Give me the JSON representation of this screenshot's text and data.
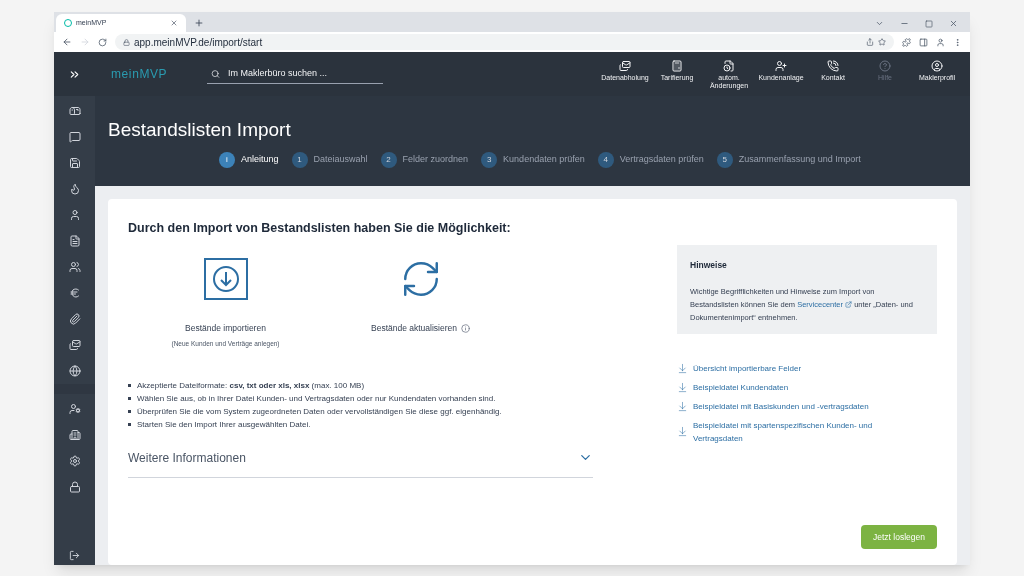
{
  "browser": {
    "tab_title": "meinMVP",
    "url": "app.meinMVP.de/import/start"
  },
  "topbar": {
    "logo": "meinMVP",
    "search_placeholder": "Im Maklerbüro suchen ...",
    "actions": [
      {
        "kind": "download",
        "label": "Datenabholung",
        "disabled": false
      },
      {
        "kind": "calculator",
        "label": "Tarifierung",
        "disabled": false
      },
      {
        "kind": "document",
        "label": "autom. Änderungen",
        "disabled": false
      },
      {
        "kind": "user-plus",
        "label": "Kundenanlage",
        "disabled": false
      },
      {
        "kind": "phone",
        "label": "Kontakt",
        "disabled": false
      },
      {
        "kind": "help",
        "label": "Hilfe",
        "disabled": true
      },
      {
        "kind": "profile",
        "label": "Maklerprofil",
        "disabled": false
      }
    ]
  },
  "page_title": "Bestandslisten Import",
  "steps": [
    {
      "number": "i",
      "label": "Anleitung",
      "selected": true
    },
    {
      "number": "1",
      "label": "Dateiauswahl",
      "selected": false
    },
    {
      "number": "2",
      "label": "Felder zuordnen",
      "selected": false
    },
    {
      "number": "3",
      "label": "Kundendaten prüfen",
      "selected": false
    },
    {
      "number": "4",
      "label": "Vertragsdaten prüfen",
      "selected": false
    },
    {
      "number": "5",
      "label": "Zusammenfassung und Import",
      "selected": false
    }
  ],
  "intro_heading": "Durch den Import von Bestandslisten haben Sie die Möglichkeit:",
  "options": [
    {
      "kind": "import",
      "label": "Bestände importieren",
      "note": "(Neue Kunden und Verträge anlegen)"
    },
    {
      "kind": "update",
      "label": "Bestände aktualisieren",
      "info": true
    }
  ],
  "bullets": [
    "Akzeptierte Dateiformate: **csv, txt oder xls, xlsx** (max. 100 MB)",
    "Wählen Sie aus, ob in Ihrer Datei Kunden- und Vertragsdaten oder nur Kundendaten vorhanden sind.",
    "Überprüfen Sie die vom System zugeordneten Daten oder vervollständigen Sie diese ggf. eigenhändig.",
    "Starten Sie den Import Ihrer ausgewählten Datei."
  ],
  "more_info": {
    "label": "Weitere Informationen",
    "expanded": false
  },
  "hints": {
    "title": "Hinweise",
    "text_before": "Wichtige Begrifflichkeiten und Hinweise zum Import von Bestandslisten können Sie dem",
    "link": "Servicecenter",
    "text_after": "unter „Daten- und Dokumentenimport“ entnehmen."
  },
  "downloads": [
    "Übersicht importierbare Felder",
    "Beispieldatei Kundendaten",
    "Beispieldatei mit Basiskunden und -vertragsdaten",
    "Beispieldatei mit spartenspezifischen Kunden- und Vertragsdaten"
  ],
  "start_button": "Jetzt loslegen"
}
